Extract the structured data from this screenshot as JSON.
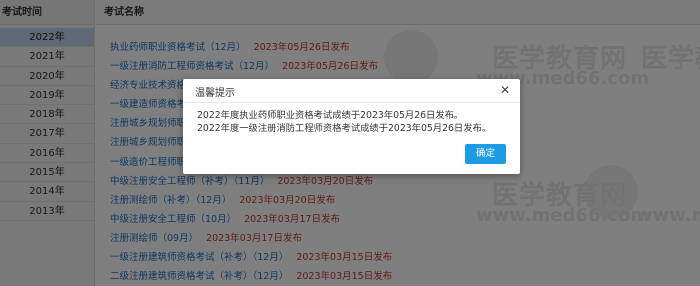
{
  "table": {
    "year_header": "考试时间",
    "name_header": "考试名称"
  },
  "years": [
    "2022年",
    "2021年",
    "2020年",
    "2019年",
    "2018年",
    "2017年",
    "2016年",
    "2015年",
    "2014年",
    "2013年"
  ],
  "active_year": "2022年",
  "exams": [
    {
      "name": "执业药师职业资格考试（12月）",
      "date": "2023年05月26日发布"
    },
    {
      "name": "一级注册消防工程师资格考试（12月）",
      "date": "2023年05月26日发布"
    },
    {
      "name": "经济专业技术资格",
      "date": ""
    },
    {
      "name": "一级建造师资格考",
      "date": ""
    },
    {
      "name": "注册城乡规划师职",
      "date": ""
    },
    {
      "name": "注册城乡规划师职",
      "date": ""
    },
    {
      "name": "一级造价工程师职",
      "date": ""
    },
    {
      "name": "中级注册安全工程师（补考）（11月）",
      "date": "2023年03月20日发布"
    },
    {
      "name": "注册测绘师（补考）（12月）",
      "date": "2023年03月20日发布"
    },
    {
      "name": "中级注册安全工程师（10月）",
      "date": "2023年03月17日发布"
    },
    {
      "name": "注册测绘师（09月）",
      "date": "2023年03月17日发布"
    },
    {
      "name": "一级注册建筑师资格考试（补考）（12月）",
      "date": "2023年03月15日发布"
    },
    {
      "name": "二级注册建筑师资格考试（补考）（12月）",
      "date": "2023年03月15日发布"
    }
  ],
  "watermark": {
    "cn": "医学教育网",
    "en": "www.med66.com"
  },
  "dialog": {
    "title": "温馨提示",
    "close_symbol": "✕",
    "lines": [
      "2022年度执业药师职业资格考试成绩于2023年05月26日发布。",
      "2022年度一级注册消防工程师资格考试成绩于2023年05月26日发布。"
    ],
    "ok_label": "确定"
  },
  "colors": {
    "link": "#1f6fc5",
    "date": "#c0392b",
    "active_year_bg": "#bcd3ea",
    "ok_button": "#1e9be6"
  }
}
